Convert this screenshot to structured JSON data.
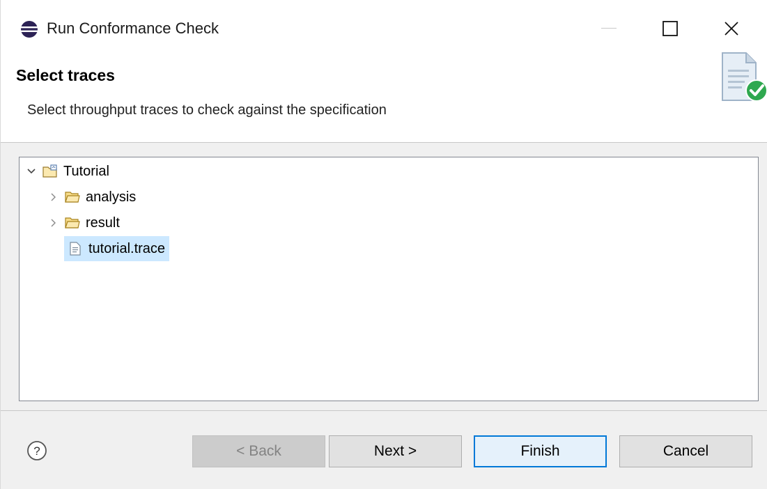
{
  "window": {
    "title": "Run Conformance Check"
  },
  "header": {
    "title": "Select traces",
    "description": "Select throughput traces to check against the specification",
    "icon": "document-check-icon"
  },
  "tree": {
    "root": {
      "label": "Tutorial",
      "icon": "project-folder-icon",
      "expanded": true
    },
    "children": [
      {
        "label": "analysis",
        "icon": "folder-icon",
        "expandable": true
      },
      {
        "label": "result",
        "icon": "folder-icon",
        "expandable": true
      },
      {
        "label": "tutorial.trace",
        "icon": "file-icon",
        "selected": true
      }
    ]
  },
  "buttons": {
    "back": "< Back",
    "next": "Next >",
    "finish": "Finish",
    "cancel": "Cancel",
    "help": "?"
  },
  "colors": {
    "selection": "#cce8ff",
    "default_button_border": "#0078d7",
    "check_green": "#2fa84f"
  }
}
